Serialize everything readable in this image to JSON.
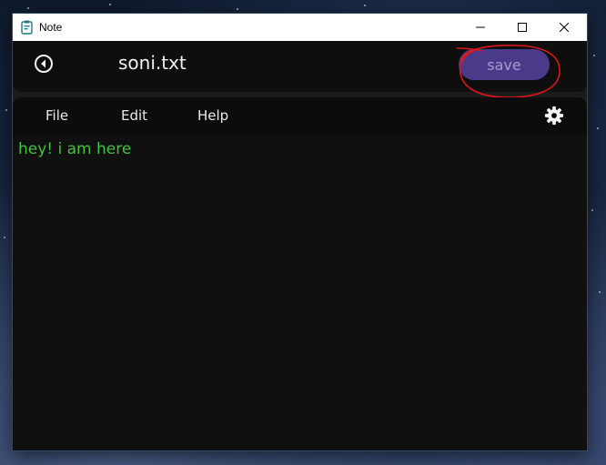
{
  "window": {
    "title": "Note"
  },
  "toolbar": {
    "file_name": "soni.txt",
    "save_label": "save"
  },
  "menu": {
    "items": [
      "File",
      "Edit",
      "Help"
    ]
  },
  "editor": {
    "content": "hey! i am here"
  },
  "colors": {
    "save_button": "#4b3a8a",
    "editor_text": "#41c33e",
    "annotation": "#e0161c"
  }
}
